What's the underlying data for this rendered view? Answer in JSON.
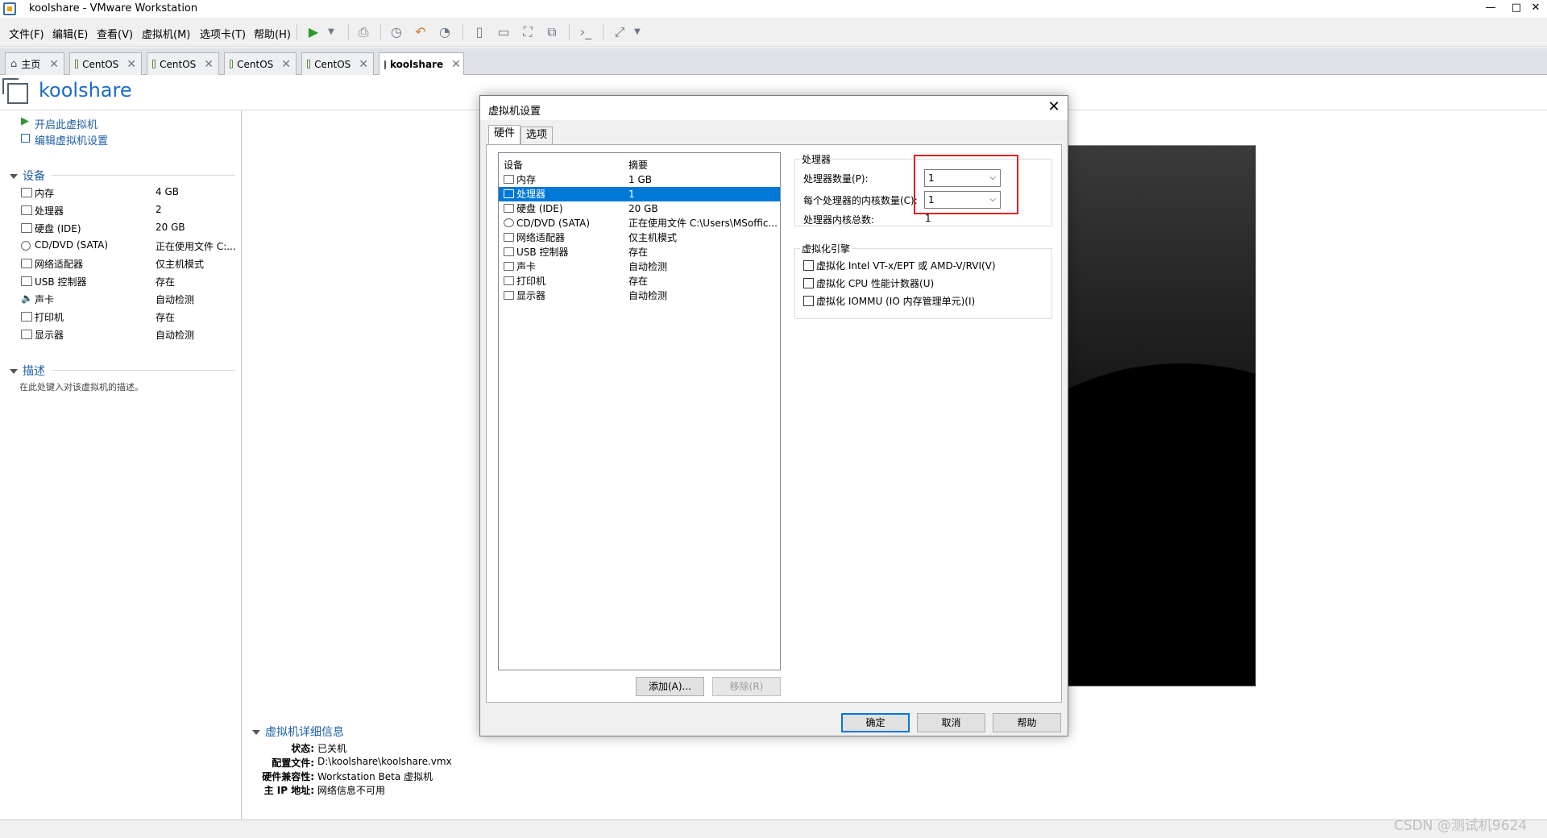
{
  "window": {
    "title": "koolshare - VMware Workstation",
    "min": "—",
    "max": "□",
    "close": "✕"
  },
  "menu": [
    "文件(F)",
    "编辑(E)",
    "查看(V)",
    "虚拟机(M)",
    "选项卡(T)",
    "帮助(H)"
  ],
  "tabs": [
    {
      "label": "主页",
      "close": "✕"
    },
    {
      "label": "CentOS",
      "close": "✕"
    },
    {
      "label": "CentOS",
      "close": "✕"
    },
    {
      "label": "CentOS",
      "close": "✕"
    },
    {
      "label": "CentOS",
      "close": "✕"
    },
    {
      "label": "koolshare",
      "close": "✕"
    }
  ],
  "vm": {
    "name": "koolshare",
    "actions": [
      "开启此虚拟机",
      "编辑虚拟机设置"
    ],
    "devices_title": "设备",
    "devices": [
      {
        "name": "内存",
        "value": "4 GB"
      },
      {
        "name": "处理器",
        "value": "2"
      },
      {
        "name": "硬盘 (IDE)",
        "value": "20 GB"
      },
      {
        "name": "CD/DVD (SATA)",
        "value": "正在使用文件 C:..."
      },
      {
        "name": "网络适配器",
        "value": "仅主机模式"
      },
      {
        "name": "USB 控制器",
        "value": "存在"
      },
      {
        "name": "声卡",
        "value": "自动检测"
      },
      {
        "name": "打印机",
        "value": "存在"
      },
      {
        "name": "显示器",
        "value": "自动检测"
      }
    ],
    "desc_title": "描述",
    "desc_placeholder": "在此处键入对该虚拟机的描述。",
    "details_title": "虚拟机详细信息",
    "details": [
      {
        "key": "状态:",
        "value": "已关机"
      },
      {
        "key": "配置文件:",
        "value": "D:\\koolshare\\koolshare.vmx"
      },
      {
        "key": "硬件兼容性:",
        "value": "Workstation Beta 虚拟机"
      },
      {
        "key": "主 IP 地址:",
        "value": "网络信息不可用"
      }
    ]
  },
  "dialog": {
    "title": "虚拟机设置",
    "close": "✕",
    "tabs": [
      "硬件",
      "选项"
    ],
    "list_headers": [
      "设备",
      "摘要"
    ],
    "list": [
      {
        "name": "内存",
        "value": "1 GB"
      },
      {
        "name": "处理器",
        "value": "1"
      },
      {
        "name": "硬盘 (IDE)",
        "value": "20 GB"
      },
      {
        "name": "CD/DVD (SATA)",
        "value": "正在使用文件 C:\\Users\\MSoffic..."
      },
      {
        "name": "网络适配器",
        "value": "仅主机模式"
      },
      {
        "name": "USB 控制器",
        "value": "存在"
      },
      {
        "name": "声卡",
        "value": "自动检测"
      },
      {
        "name": "打印机",
        "value": "存在"
      },
      {
        "name": "显示器",
        "value": "自动检测"
      }
    ],
    "selected_index": 1,
    "add_label": "添加(A)...",
    "remove_label": "移除(R)",
    "processor": {
      "group": "处理器",
      "count_label": "处理器数量(P):",
      "count_value": "1",
      "cores_label": "每个处理器的内核数量(C):",
      "cores_value": "1",
      "total_label": "处理器内核总数:",
      "total_value": "1"
    },
    "virt": {
      "group": "虚拟化引擎",
      "options": [
        "虚拟化 Intel VT-x/EPT 或 AMD-V/RVI(V)",
        "虚拟化 CPU 性能计数器(U)",
        "虚拟化 IOMMU (IO 内存管理单元)(I)"
      ]
    },
    "ok": "确定",
    "cancel": "取消",
    "help": "帮助"
  },
  "watermark": "CSDN @测试机9624"
}
